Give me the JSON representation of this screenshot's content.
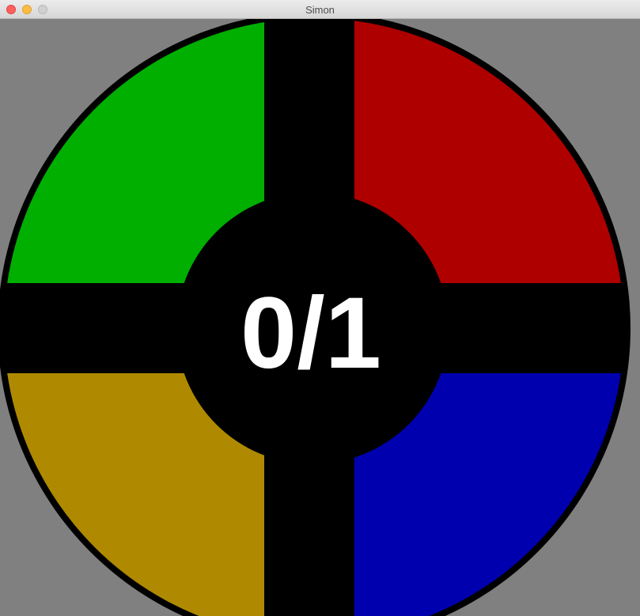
{
  "window": {
    "title": "Simon"
  },
  "game": {
    "score_text": "0/1",
    "background_color": "#808080",
    "ring_color": "#000000",
    "score_color": "#ffffff",
    "pads": [
      {
        "id": "green",
        "color": "#00af00"
      },
      {
        "id": "red",
        "color": "#af0000"
      },
      {
        "id": "yellow",
        "color": "#af8a00"
      },
      {
        "id": "blue",
        "color": "#0000af"
      }
    ]
  }
}
